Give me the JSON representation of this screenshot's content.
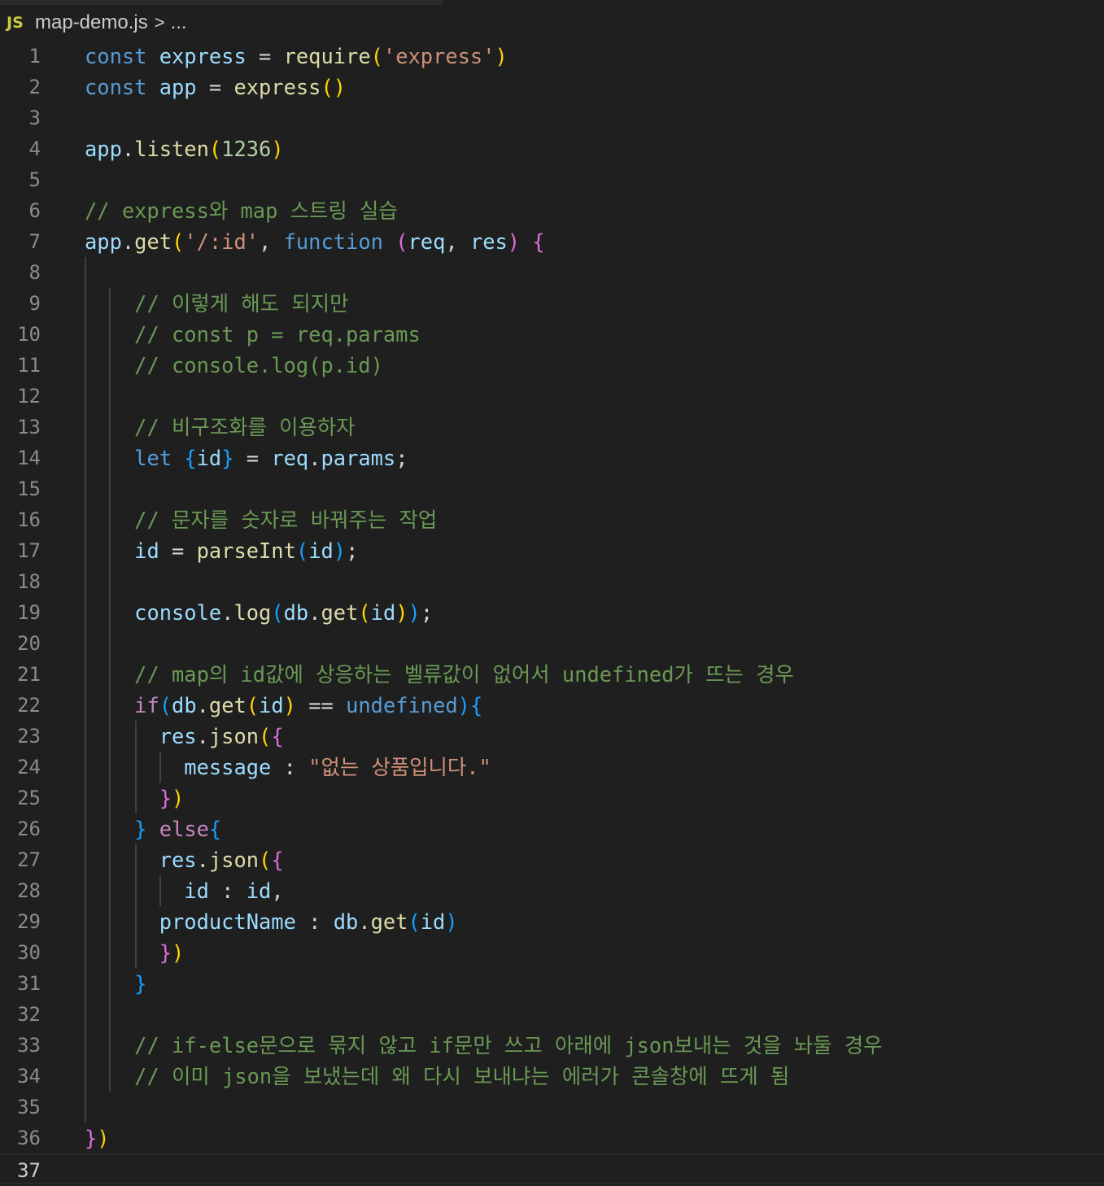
{
  "breadcrumb": {
    "icon": "JS",
    "file": "map-demo.js",
    "separator": ">",
    "ellipsis": "..."
  },
  "editor": {
    "active_line": 37,
    "lines": [
      {
        "n": 1,
        "tokens": [
          {
            "t": "const",
            "c": "k"
          },
          {
            "t": " "
          },
          {
            "t": "express",
            "c": "v"
          },
          {
            "t": " = "
          },
          {
            "t": "require",
            "c": "f"
          },
          {
            "t": "(",
            "c": "b1"
          },
          {
            "t": "'express'",
            "c": "s"
          },
          {
            "t": ")",
            "c": "b1"
          }
        ]
      },
      {
        "n": 2,
        "tokens": [
          {
            "t": "const",
            "c": "k"
          },
          {
            "t": " "
          },
          {
            "t": "app",
            "c": "v"
          },
          {
            "t": " = "
          },
          {
            "t": "express",
            "c": "f"
          },
          {
            "t": "()",
            "c": "b1"
          }
        ]
      },
      {
        "n": 3,
        "tokens": []
      },
      {
        "n": 4,
        "tokens": [
          {
            "t": "app",
            "c": "v"
          },
          {
            "t": "."
          },
          {
            "t": "listen",
            "c": "f"
          },
          {
            "t": "(",
            "c": "b1"
          },
          {
            "t": "1236",
            "c": "n"
          },
          {
            "t": ")",
            "c": "b1"
          }
        ]
      },
      {
        "n": 5,
        "tokens": []
      },
      {
        "n": 6,
        "tokens": [
          {
            "t": "// express와 map 스트링 실습",
            "c": "c"
          }
        ]
      },
      {
        "n": 7,
        "tokens": [
          {
            "t": "app",
            "c": "v"
          },
          {
            "t": "."
          },
          {
            "t": "get",
            "c": "f"
          },
          {
            "t": "(",
            "c": "b1"
          },
          {
            "t": "'/:id'",
            "c": "s"
          },
          {
            "t": ", "
          },
          {
            "t": "function",
            "c": "k"
          },
          {
            "t": " "
          },
          {
            "t": "(",
            "c": "b2"
          },
          {
            "t": "req",
            "c": "v"
          },
          {
            "t": ", "
          },
          {
            "t": "res",
            "c": "v"
          },
          {
            "t": ")",
            "c": "b2"
          },
          {
            "t": " "
          },
          {
            "t": "{",
            "c": "b2"
          }
        ]
      },
      {
        "n": 8,
        "tokens": []
      },
      {
        "n": 9,
        "tokens": [
          {
            "t": "    "
          },
          {
            "t": "// 이렇게 해도 되지만",
            "c": "c"
          }
        ]
      },
      {
        "n": 10,
        "tokens": [
          {
            "t": "    "
          },
          {
            "t": "// const p = req.params",
            "c": "c"
          }
        ]
      },
      {
        "n": 11,
        "tokens": [
          {
            "t": "    "
          },
          {
            "t": "// console.log(p.id)",
            "c": "c"
          }
        ]
      },
      {
        "n": 12,
        "tokens": []
      },
      {
        "n": 13,
        "tokens": [
          {
            "t": "    "
          },
          {
            "t": "// 비구조화를 이용하자",
            "c": "c"
          }
        ]
      },
      {
        "n": 14,
        "tokens": [
          {
            "t": "    "
          },
          {
            "t": "let",
            "c": "k"
          },
          {
            "t": " "
          },
          {
            "t": "{",
            "c": "b3"
          },
          {
            "t": "id",
            "c": "v"
          },
          {
            "t": "}",
            "c": "b3"
          },
          {
            "t": " = "
          },
          {
            "t": "req",
            "c": "v"
          },
          {
            "t": "."
          },
          {
            "t": "params",
            "c": "v"
          },
          {
            "t": ";"
          }
        ]
      },
      {
        "n": 15,
        "tokens": []
      },
      {
        "n": 16,
        "tokens": [
          {
            "t": "    "
          },
          {
            "t": "// 문자를 숫자로 바꿔주는 작업",
            "c": "c"
          }
        ]
      },
      {
        "n": 17,
        "tokens": [
          {
            "t": "    "
          },
          {
            "t": "id",
            "c": "v"
          },
          {
            "t": " = "
          },
          {
            "t": "parseInt",
            "c": "f"
          },
          {
            "t": "(",
            "c": "b3"
          },
          {
            "t": "id",
            "c": "v"
          },
          {
            "t": ")",
            "c": "b3"
          },
          {
            "t": ";"
          }
        ]
      },
      {
        "n": 18,
        "tokens": []
      },
      {
        "n": 19,
        "tokens": [
          {
            "t": "    "
          },
          {
            "t": "console",
            "c": "v"
          },
          {
            "t": "."
          },
          {
            "t": "log",
            "c": "f"
          },
          {
            "t": "(",
            "c": "b3"
          },
          {
            "t": "db",
            "c": "v"
          },
          {
            "t": "."
          },
          {
            "t": "get",
            "c": "f"
          },
          {
            "t": "(",
            "c": "b1"
          },
          {
            "t": "id",
            "c": "v"
          },
          {
            "t": ")",
            "c": "b1"
          },
          {
            "t": ")",
            "c": "b3"
          },
          {
            "t": ";"
          }
        ]
      },
      {
        "n": 20,
        "tokens": []
      },
      {
        "n": 21,
        "tokens": [
          {
            "t": "    "
          },
          {
            "t": "// map의 id값에 상응하는 벨류값이 없어서 undefined가 뜨는 경우",
            "c": "c"
          }
        ]
      },
      {
        "n": 22,
        "tokens": [
          {
            "t": "    "
          },
          {
            "t": "if",
            "c": "kc"
          },
          {
            "t": "(",
            "c": "b3"
          },
          {
            "t": "db",
            "c": "v"
          },
          {
            "t": "."
          },
          {
            "t": "get",
            "c": "f"
          },
          {
            "t": "(",
            "c": "b1"
          },
          {
            "t": "id",
            "c": "v"
          },
          {
            "t": ")",
            "c": "b1"
          },
          {
            "t": " == "
          },
          {
            "t": "undefined",
            "c": "k"
          },
          {
            "t": ")",
            "c": "b3"
          },
          {
            "t": "{",
            "c": "b3"
          }
        ]
      },
      {
        "n": 23,
        "tokens": [
          {
            "t": "      "
          },
          {
            "t": "res",
            "c": "v"
          },
          {
            "t": "."
          },
          {
            "t": "json",
            "c": "f"
          },
          {
            "t": "(",
            "c": "b1"
          },
          {
            "t": "{",
            "c": "b2"
          }
        ]
      },
      {
        "n": 24,
        "tokens": [
          {
            "t": "        "
          },
          {
            "t": "message",
            "c": "v"
          },
          {
            "t": " : "
          },
          {
            "t": "\"없는 상품입니다.\"",
            "c": "s"
          }
        ]
      },
      {
        "n": 25,
        "tokens": [
          {
            "t": "      "
          },
          {
            "t": "}",
            "c": "b2"
          },
          {
            "t": ")",
            "c": "b1"
          }
        ]
      },
      {
        "n": 26,
        "tokens": [
          {
            "t": "    "
          },
          {
            "t": "}",
            "c": "b3"
          },
          {
            "t": " "
          },
          {
            "t": "else",
            "c": "kc"
          },
          {
            "t": "{",
            "c": "b3"
          }
        ]
      },
      {
        "n": 27,
        "tokens": [
          {
            "t": "      "
          },
          {
            "t": "res",
            "c": "v"
          },
          {
            "t": "."
          },
          {
            "t": "json",
            "c": "f"
          },
          {
            "t": "(",
            "c": "b1"
          },
          {
            "t": "{",
            "c": "b2"
          }
        ]
      },
      {
        "n": 28,
        "tokens": [
          {
            "t": "        "
          },
          {
            "t": "id",
            "c": "v"
          },
          {
            "t": " : "
          },
          {
            "t": "id",
            "c": "v"
          },
          {
            "t": ","
          }
        ]
      },
      {
        "n": 29,
        "tokens": [
          {
            "t": "      "
          },
          {
            "t": "productName",
            "c": "v"
          },
          {
            "t": " : "
          },
          {
            "t": "db",
            "c": "v"
          },
          {
            "t": "."
          },
          {
            "t": "get",
            "c": "f"
          },
          {
            "t": "(",
            "c": "b3"
          },
          {
            "t": "id",
            "c": "v"
          },
          {
            "t": ")",
            "c": "b3"
          }
        ]
      },
      {
        "n": 30,
        "tokens": [
          {
            "t": "      "
          },
          {
            "t": "}",
            "c": "b2"
          },
          {
            "t": ")",
            "c": "b1"
          }
        ]
      },
      {
        "n": 31,
        "tokens": [
          {
            "t": "    "
          },
          {
            "t": "}",
            "c": "b3"
          }
        ]
      },
      {
        "n": 32,
        "tokens": []
      },
      {
        "n": 33,
        "tokens": [
          {
            "t": "    "
          },
          {
            "t": "// if-else문으로 묶지 않고 if문만 쓰고 아래에 json보내는 것을 놔둘 경우",
            "c": "c"
          }
        ]
      },
      {
        "n": 34,
        "tokens": [
          {
            "t": "    "
          },
          {
            "t": "// 이미 json을 보냈는데 왜 다시 보내냐는 에러가 콘솔창에 뜨게 됨",
            "c": "c"
          }
        ]
      },
      {
        "n": 35,
        "tokens": []
      },
      {
        "n": 36,
        "tokens": [
          {
            "t": "}",
            "c": "b2"
          },
          {
            "t": ")",
            "c": "b1"
          }
        ]
      },
      {
        "n": 37,
        "tokens": []
      }
    ]
  },
  "colors": {
    "background": "#1f1f1f",
    "keyword": "#569cd6",
    "control": "#c586c0",
    "variable": "#9cdcfe",
    "function": "#dcdcaa",
    "string": "#ce9178",
    "number": "#b5cea8",
    "comment": "#6a9955",
    "js_icon": "#cbcb41"
  }
}
